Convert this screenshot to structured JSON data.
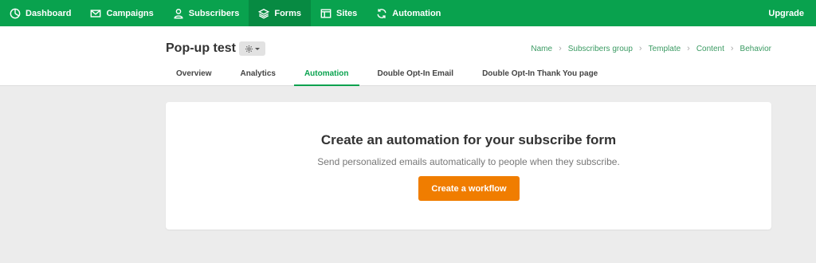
{
  "nav": {
    "items": [
      {
        "label": "Dashboard",
        "icon": "dashboard-icon"
      },
      {
        "label": "Campaigns",
        "icon": "envelope-icon"
      },
      {
        "label": "Subscribers",
        "icon": "user-icon"
      },
      {
        "label": "Forms",
        "icon": "layers-icon",
        "active": true
      },
      {
        "label": "Sites",
        "icon": "browser-icon"
      },
      {
        "label": "Automation",
        "icon": "refresh-icon"
      }
    ],
    "upgrade": "Upgrade"
  },
  "header": {
    "title": "Pop-up test",
    "breadcrumb": [
      "Name",
      "Subscribers group",
      "Template",
      "Content",
      "Behavior"
    ],
    "tabs": [
      "Overview",
      "Analytics",
      "Automation",
      "Double Opt-In Email",
      "Double Opt-In Thank You page"
    ],
    "active_tab": "Automation"
  },
  "card": {
    "title": "Create an automation for your subscribe form",
    "subtitle": "Send personalized emails automatically to people when they subscribe.",
    "button": "Create a workflow"
  },
  "colors": {
    "brand_green": "#09a24e",
    "active_nav": "#078a42",
    "cta_orange": "#f07d00"
  }
}
